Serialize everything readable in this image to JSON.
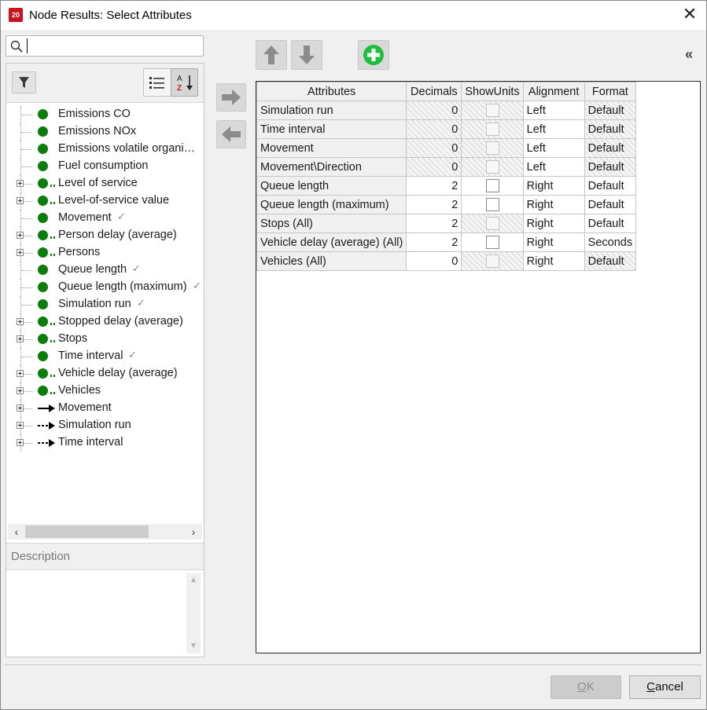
{
  "window": {
    "title": "Node Results: Select Attributes",
    "app_icon_text": "20"
  },
  "search": {
    "value": "",
    "placeholder": ""
  },
  "tree": {
    "items": [
      {
        "label": "Emissions CO",
        "icon": "green-dot",
        "expandable": false,
        "selected": false
      },
      {
        "label": "Emissions NOx",
        "icon": "green-dot",
        "expandable": false,
        "selected": false
      },
      {
        "label": "Emissions volatile organi…",
        "icon": "green-dot",
        "expandable": false,
        "selected": false
      },
      {
        "label": "Fuel consumption",
        "icon": "green-dot",
        "expandable": false,
        "selected": false
      },
      {
        "label": "Level of service",
        "icon": "green-dot-relation",
        "expandable": true,
        "selected": false
      },
      {
        "label": "Level-of-service value",
        "icon": "green-dot-relation",
        "expandable": true,
        "selected": false
      },
      {
        "label": "Movement",
        "icon": "green-dot",
        "expandable": false,
        "selected": true
      },
      {
        "label": "Person delay (average)",
        "icon": "green-dot-relation",
        "expandable": true,
        "selected": false
      },
      {
        "label": "Persons",
        "icon": "green-dot-relation",
        "expandable": true,
        "selected": false
      },
      {
        "label": "Queue length",
        "icon": "green-dot",
        "expandable": false,
        "selected": true
      },
      {
        "label": "Queue length (maximum)",
        "icon": "green-dot",
        "expandable": false,
        "selected": true
      },
      {
        "label": "Simulation run",
        "icon": "green-dot",
        "expandable": false,
        "selected": true
      },
      {
        "label": "Stopped delay (average)",
        "icon": "green-dot-relation",
        "expandable": true,
        "selected": false
      },
      {
        "label": "Stops",
        "icon": "green-dot-relation",
        "expandable": true,
        "selected": false
      },
      {
        "label": "Time interval",
        "icon": "green-dot",
        "expandable": false,
        "selected": true
      },
      {
        "label": "Vehicle delay (average)",
        "icon": "green-dot-relation",
        "expandable": true,
        "selected": false
      },
      {
        "label": "Vehicles",
        "icon": "green-dot-relation",
        "expandable": true,
        "selected": false
      },
      {
        "label": "Movement",
        "icon": "solid-arrow",
        "expandable": true,
        "selected": false
      },
      {
        "label": "Simulation run",
        "icon": "dashed-arrow",
        "expandable": true,
        "selected": false
      },
      {
        "label": "Time interval",
        "icon": "dashed-arrow",
        "expandable": true,
        "selected": false
      }
    ]
  },
  "description": {
    "header": "Description",
    "text": ""
  },
  "grid": {
    "columns": [
      "Attributes",
      "Decimals",
      "ShowUnits",
      "Alignment",
      "Format"
    ],
    "rows": [
      {
        "attribute": "Simulation run",
        "decimals": "0",
        "decimals_editable": false,
        "showunits_editable": false,
        "showunits_checked": false,
        "alignment": "Left",
        "format": "Default",
        "format_editable": false
      },
      {
        "attribute": "Time interval",
        "decimals": "0",
        "decimals_editable": false,
        "showunits_editable": false,
        "showunits_checked": false,
        "alignment": "Left",
        "format": "Default",
        "format_editable": false
      },
      {
        "attribute": "Movement",
        "decimals": "0",
        "decimals_editable": false,
        "showunits_editable": false,
        "showunits_checked": false,
        "alignment": "Left",
        "format": "Default",
        "format_editable": false
      },
      {
        "attribute": "Movement\\Direction",
        "decimals": "0",
        "decimals_editable": false,
        "showunits_editable": false,
        "showunits_checked": false,
        "alignment": "Left",
        "format": "Default",
        "format_editable": false
      },
      {
        "attribute": "Queue length",
        "decimals": "2",
        "decimals_editable": true,
        "showunits_editable": true,
        "showunits_checked": false,
        "alignment": "Right",
        "format": "Default",
        "format_editable": true
      },
      {
        "attribute": "Queue length (maximum)",
        "decimals": "2",
        "decimals_editable": true,
        "showunits_editable": true,
        "showunits_checked": false,
        "alignment": "Right",
        "format": "Default",
        "format_editable": true
      },
      {
        "attribute": "Stops (All)",
        "decimals": "2",
        "decimals_editable": true,
        "showunits_editable": false,
        "showunits_checked": false,
        "alignment": "Right",
        "format": "Default",
        "format_editable": true
      },
      {
        "attribute": "Vehicle delay (average) (All)",
        "decimals": "2",
        "decimals_editable": true,
        "showunits_editable": true,
        "showunits_checked": false,
        "alignment": "Right",
        "format": "Seconds",
        "format_editable": true
      },
      {
        "attribute": "Vehicles (All)",
        "decimals": "0",
        "decimals_editable": true,
        "showunits_editable": false,
        "showunits_checked": false,
        "alignment": "Right",
        "format": "Default",
        "format_editable": false
      }
    ]
  },
  "buttons": {
    "ok": "OK",
    "ok_accesskey": "O",
    "cancel": "Cancel",
    "cancel_accesskey": "C",
    "ok_enabled": false
  },
  "colors": {
    "attribute_dot": "#0a7d0a",
    "add_button": "#1dbf3b"
  }
}
